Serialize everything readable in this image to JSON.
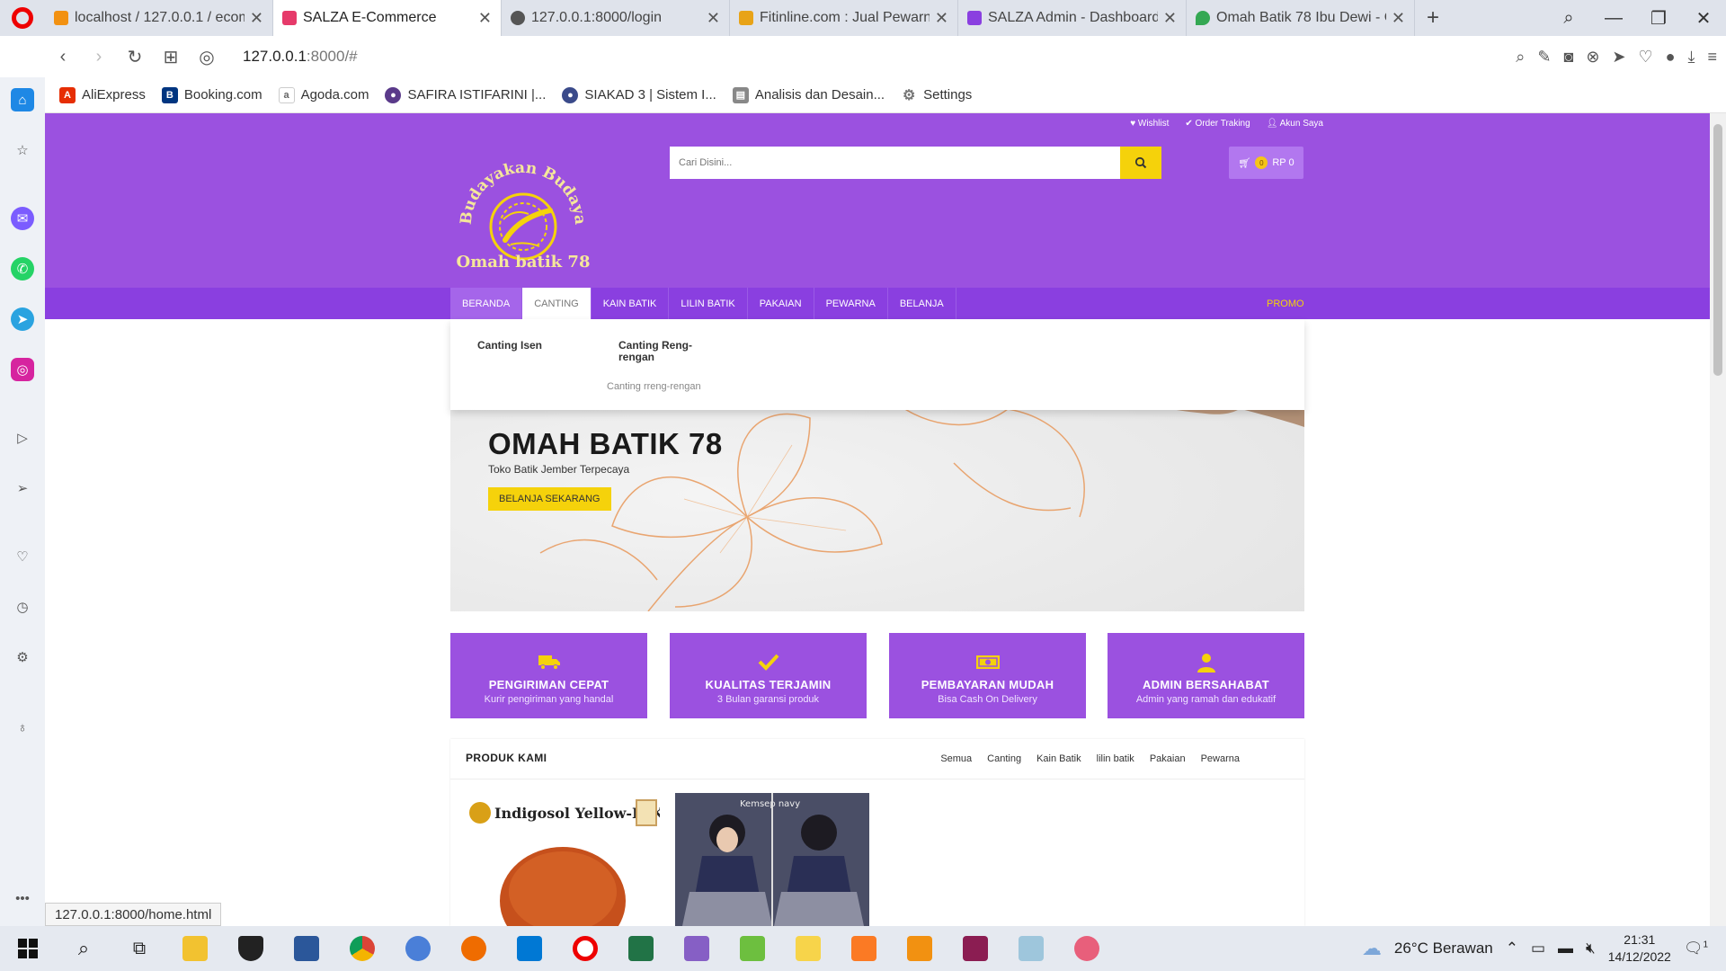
{
  "browser": {
    "tabs": [
      {
        "title": "localhost / 127.0.0.1 / ecom",
        "color": "#f29111"
      },
      {
        "title": "SALZA E-Commerce",
        "color": "#e63a6a"
      },
      {
        "title": "127.0.0.1:8000/login",
        "color": "#555555"
      },
      {
        "title": "Fitinline.com : Jual Pewarna",
        "color": "#e8a317"
      },
      {
        "title": "SALZA Admin - Dashboard",
        "color": "#8a3fe0"
      },
      {
        "title": "Omah Batik 78 Ibu Dewi - G",
        "color": "#34a853"
      }
    ],
    "url_host": "127.0.0.1",
    "url_rest": ":8000/#",
    "bookmarks": [
      {
        "label": "AliExpress",
        "color": "#e62e04"
      },
      {
        "label": "Booking.com",
        "color": "#003580"
      },
      {
        "label": "Agoda.com",
        "color": "#666666"
      },
      {
        "label": "SAFIRA ISTIFARINI |...",
        "color": "#5a3a8a"
      },
      {
        "label": "SIAKAD 3 | Sistem I...",
        "color": "#3a4a8a"
      },
      {
        "label": "Analisis dan Desain...",
        "color": "#888888"
      },
      {
        "label": "Settings",
        "color": "#777777"
      }
    ],
    "status_url": "127.0.0.1:8000/home.html"
  },
  "site": {
    "top_links": [
      "Wishlist",
      "Order Traking",
      "Akun Saya"
    ],
    "logo_top": "Budayakan Budaya",
    "logo_bottom": "Omah batik 78",
    "search_placeholder": "Cari Disini...",
    "cart_count": "0",
    "cart_total": "RP 0",
    "nav": [
      "BERANDA",
      "CANTING",
      "KAIN BATIK",
      "LILIN BATIK",
      "PAKAIAN",
      "PEWARNA",
      "BELANJA"
    ],
    "promo": "PROMO",
    "dropdown": {
      "col1": "Canting Isen",
      "col2": "Canting Reng-rengan",
      "link": "Canting rreng-rengan"
    },
    "hero": {
      "title": "OMAH BATIK 78",
      "subtitle": "Toko Batik Jember Terpecaya",
      "button": "BELANJA SEKARANG"
    },
    "features": [
      {
        "icon": "truck-icon",
        "title": "PENGIRIMAN CEPAT",
        "sub": "Kurir pengiriman yang handal"
      },
      {
        "icon": "check-icon",
        "title": "KUALITAS TERJAMIN",
        "sub": "3 Bulan garansi produk"
      },
      {
        "icon": "money-icon",
        "title": "PEMBAYARAN MUDAH",
        "sub": "Bisa Cash On Delivery"
      },
      {
        "icon": "user-icon",
        "title": "ADMIN BERSAHABAT",
        "sub": "Admin yang ramah dan edukatif"
      }
    ],
    "products_title": "PRODUK KAMI",
    "filters": [
      "Semua",
      "Canting",
      "Kain Batik",
      "lilin batik",
      "Pakaian",
      "Pewarna"
    ],
    "product1_label": "Indigosol Yellow-IGK",
    "product2_label": "Kemsep navy"
  },
  "taskbar": {
    "weather": "26°C  Berawan",
    "time": "21:31",
    "date": "14/12/2022",
    "notifications": "1"
  },
  "colors": {
    "brand_purple": "#9b51e0",
    "nav_purple": "#8a3fe0",
    "accent_yellow": "#f5d20b"
  }
}
